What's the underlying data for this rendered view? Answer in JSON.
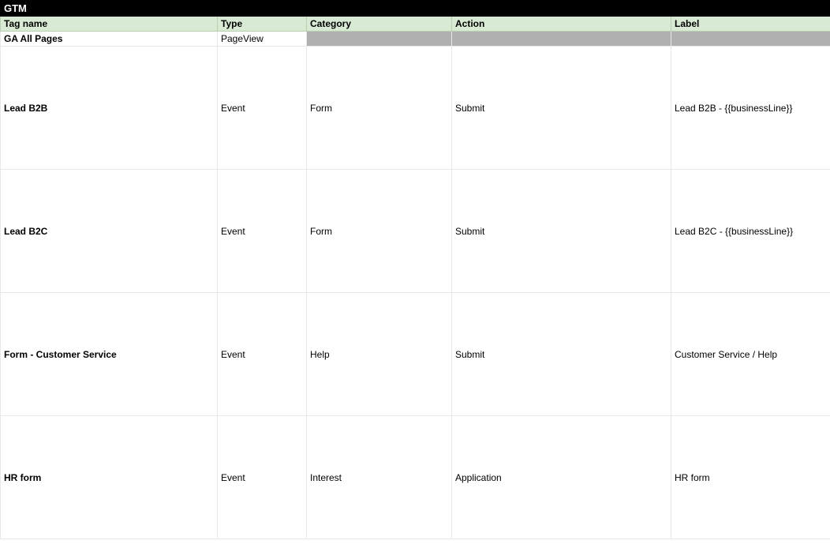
{
  "title": "GTM",
  "headers": [
    "Tag name",
    "Type",
    "Category",
    "Action",
    "Label"
  ],
  "rows": [
    {
      "tag": "GA All Pages",
      "type": "PageView",
      "category": "",
      "action": "",
      "label": "",
      "grey": true,
      "short": true
    },
    {
      "tag": "Lead B2B",
      "type": "Event",
      "category": "Form",
      "action": "Submit",
      "label": "Lead B2B - {{businessLine}}"
    },
    {
      "tag": "Lead B2C",
      "type": "Event",
      "category": "Form",
      "action": "Submit",
      "label": "Lead B2C - {{businessLine}}"
    },
    {
      "tag": "Form - Customer Service",
      "type": "Event",
      "category": "Help",
      "action": "Submit",
      "label": "Customer Service / Help"
    },
    {
      "tag": "HR form",
      "type": "Event",
      "category": "Interest",
      "action": "Application",
      "label": "HR form"
    }
  ]
}
